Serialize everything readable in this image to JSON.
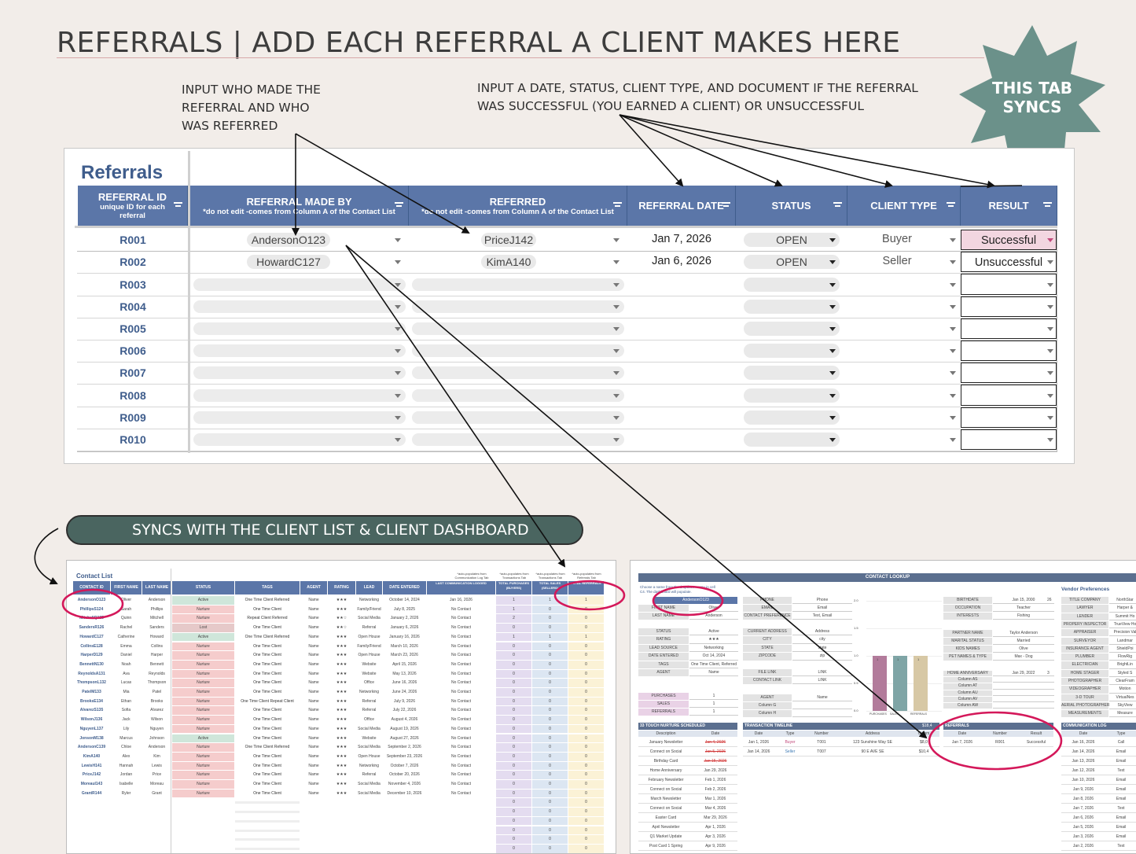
{
  "page": {
    "title": "REFERRALS | ADD EACH REFERRAL A CLIENT MAKES HERE",
    "note_left": [
      "INPUT WHO MADE THE",
      "REFERRAL AND WHO",
      "WAS REFERRED"
    ],
    "note_right": [
      "INPUT A DATE, STATUS, CLIENT TYPE, AND DOCUMENT IF THE REFERRAL",
      "WAS SUCCESSFUL (YOU EARNED A CLIENT) OR UNSUCCESSFUL"
    ],
    "badge": [
      "THIS TAB",
      "SYNCS"
    ],
    "banner": "SYNCS WITH THE CLIENT LIST & CLIENT DASHBOARD",
    "colors": {
      "header_blue": "#5b76a8",
      "badge_green": "#6b918a",
      "banner_green": "#4a6560",
      "circle_pink": "#d4185a"
    }
  },
  "sheet": {
    "title": "Referrals",
    "columns": [
      {
        "label": "REFERRAL ID",
        "sub": [
          "unique ID for each",
          "referral"
        ]
      },
      {
        "label": "REFERRAL MADE BY",
        "sub": [
          "*do not edit -comes from Column A of the Contact List"
        ]
      },
      {
        "label": "REFERRED",
        "sub": [
          "*do not edit -comes from Column A of the Contact List"
        ]
      },
      {
        "label": "REFERRAL DATE",
        "sub": []
      },
      {
        "label": "STATUS",
        "sub": []
      },
      {
        "label": "CLIENT TYPE",
        "sub": []
      },
      {
        "label": "RESULT",
        "sub": []
      }
    ],
    "rows": [
      {
        "id": "R001",
        "made_by": "AndersonO123",
        "referred": "PriceJ142",
        "date": "Jan 7, 2026",
        "status": "OPEN",
        "client_type": "Buyer",
        "result": "Successful"
      },
      {
        "id": "R002",
        "made_by": "HowardC127",
        "referred": "KimA140",
        "date": "Jan 6, 2026",
        "status": "OPEN",
        "client_type": "Seller",
        "result": "Unsuccessful"
      },
      {
        "id": "R003"
      },
      {
        "id": "R004"
      },
      {
        "id": "R005"
      },
      {
        "id": "R006"
      },
      {
        "id": "R007"
      },
      {
        "id": "R008"
      },
      {
        "id": "R009"
      },
      {
        "id": "R010"
      }
    ]
  },
  "contact_list": {
    "title": "Contact List",
    "notes": [
      "*auto-populates from Communication Log Tab",
      "*auto-populates from Transactions Tab",
      "*auto-populates from Transactions Tab",
      "*auto-populates from Referrals Tab"
    ],
    "headers": [
      "CONTACT ID",
      "FIRST NAME",
      "LAST NAME",
      "STATUS",
      "TAGS",
      "AGENT",
      "RATING",
      "LEAD SOURCE",
      "DATE ENTERED",
      "LAST COMMUNICATION LOGGED",
      "TOTAL PURCHASES (BUYERS)",
      "TOTAL SALES (SELLERS)",
      "TOTAL REFERRALS"
    ],
    "rows": [
      [
        "AndersonO123",
        "Oliver",
        "Anderson",
        "Active",
        "One Time Client  Referred",
        "Name",
        "★★★",
        "Networking",
        "October 14, 2024",
        "Jan 16, 2026",
        "1",
        "1",
        "1"
      ],
      [
        "PhillipsS124",
        "Sarah",
        "Phillips",
        "Nurture",
        "One Time Client",
        "Name",
        "★★★",
        "Family/Friend",
        "July 8, 2025",
        "No Contact",
        "1",
        "0",
        "0"
      ],
      [
        "MitchellQ125",
        "Quinn",
        "Mitchell",
        "Nurture",
        "Repeat Client  Referred",
        "Name",
        "★★☆",
        "Social Media",
        "January 2, 2026",
        "No Contact",
        "2",
        "0",
        "0"
      ],
      [
        "SandersR126",
        "Rachel",
        "Sanders",
        "Lost",
        "One Time Client",
        "Name",
        "★★☆",
        "Referral",
        "January 6, 2026",
        "No Contact",
        "0",
        "0",
        "0"
      ],
      [
        "HowardC127",
        "Catherine",
        "Howard",
        "Active",
        "One Time Client  Referred",
        "Name",
        "★★★",
        "Open House",
        "January 16, 2026",
        "No Contact",
        "1",
        "1",
        "1"
      ],
      [
        "CollinsE128",
        "Emma",
        "Collins",
        "Nurture",
        "One Time Client",
        "Name",
        "★★★",
        "Family/Friend",
        "March 10, 2026",
        "No Contact",
        "0",
        "0",
        "0"
      ],
      [
        "HarperD129",
        "Daniel",
        "Harper",
        "Nurture",
        "One Time Client",
        "Name",
        "★★★",
        "Open House",
        "March 23, 2026",
        "No Contact",
        "0",
        "0",
        "0"
      ],
      [
        "BennettN130",
        "Noah",
        "Bennett",
        "Nurture",
        "One Time Client",
        "Name",
        "★★★",
        "Website",
        "April 15, 2026",
        "No Contact",
        "0",
        "0",
        "0"
      ],
      [
        "ReynoldsA131",
        "Ava",
        "Reynolds",
        "Nurture",
        "One Time Client",
        "Name",
        "★★★",
        "Website",
        "May 13, 2026",
        "No Contact",
        "0",
        "0",
        "0"
      ],
      [
        "ThompsonL132",
        "Lucas",
        "Thompson",
        "Nurture",
        "One Time Client",
        "Name",
        "★★★",
        "Office",
        "June 16, 2026",
        "No Contact",
        "0",
        "0",
        "0"
      ],
      [
        "PatelM133",
        "Mia",
        "Patel",
        "Nurture",
        "One Time Client",
        "Name",
        "★★★",
        "Networking",
        "June 24, 2026",
        "No Contact",
        "0",
        "0",
        "0"
      ],
      [
        "BrooksE134",
        "Ethan",
        "Brooks",
        "Nurture",
        "One Time Client  Repeat Client",
        "Name",
        "★★★",
        "Referral",
        "July 9, 2026",
        "No Contact",
        "0",
        "0",
        "0"
      ],
      [
        "AlvarezS135",
        "Sofia",
        "Alvarez",
        "Nurture",
        "One Time Client",
        "Name",
        "★★★",
        "Referral",
        "July 22, 2026",
        "No Contact",
        "0",
        "0",
        "0"
      ],
      [
        "WilsonJ136",
        "Jack",
        "Wilson",
        "Nurture",
        "One Time Client",
        "Name",
        "★★★",
        "Office",
        "August 4, 2026",
        "No Contact",
        "0",
        "0",
        "0"
      ],
      [
        "NguyenL137",
        "Lily",
        "Nguyen",
        "Nurture",
        "One Time Client",
        "Name",
        "★★★",
        "Social Media",
        "August 19, 2026",
        "No Contact",
        "0",
        "0",
        "0"
      ],
      [
        "JonsonM138",
        "Marcus",
        "Johnson",
        "Active",
        "One Time Client",
        "Name",
        "★★★",
        "Website",
        "August 27, 2026",
        "No Contact",
        "0",
        "0",
        "0"
      ],
      [
        "AndersonC139",
        "Chloe",
        "Anderson",
        "Nurture",
        "One Time Client  Referred",
        "Name",
        "★★★",
        "Social Media",
        "September 2, 2026",
        "No Contact",
        "0",
        "0",
        "0"
      ],
      [
        "KimA140",
        "Alex",
        "Kim",
        "Nurture",
        "One Time Client",
        "Name",
        "★★★",
        "Open House",
        "September 23, 2026",
        "No Contact",
        "0",
        "0",
        "0"
      ],
      [
        "LewisH141",
        "Hannah",
        "Lewis",
        "Nurture",
        "One Time Client",
        "Name",
        "★★★",
        "Networking",
        "October 7, 2026",
        "No Contact",
        "0",
        "0",
        "0"
      ],
      [
        "PriceJ142",
        "Jordan",
        "Price",
        "Nurture",
        "One Time Client",
        "Name",
        "★★★",
        "Referral",
        "October 20, 2026",
        "No Contact",
        "0",
        "0",
        "0"
      ],
      [
        "MoreauI143",
        "Isabelle",
        "Moreau",
        "Nurture",
        "One Time Client",
        "Name",
        "★★★",
        "Social Media",
        "November 4, 2026",
        "No Contact",
        "0",
        "0",
        "0"
      ],
      [
        "GrantR144",
        "Ryler",
        "Grant",
        "Nurture",
        "One Time Client",
        "Name",
        "★★★",
        "Social Media",
        "December 10, 2026",
        "No Contact",
        "0",
        "0",
        "0"
      ]
    ]
  },
  "dashboard": {
    "title": "CONTACT LOOKUP",
    "instruction": [
      "Choose a name from the dropdown menu in cell",
      "C4. The dashboard will populate."
    ],
    "selected": "AndersonO123",
    "fields_a": [
      [
        "FIRST NAME",
        "Oliver"
      ],
      [
        "LAST NAME",
        "Anderson"
      ]
    ],
    "fields_b": [
      [
        "STATUS",
        "Active"
      ],
      [
        "RATING",
        "★★★"
      ],
      [
        "LEAD SOURCE",
        "Networking"
      ],
      [
        "DATE ENTERED",
        "Oct 14, 2024"
      ],
      [
        "TAGS",
        "One Time Client, Referred"
      ],
      [
        "AGENT",
        "Name"
      ]
    ],
    "fields_c": [
      [
        "PURCHASES",
        "1"
      ],
      [
        "SALES",
        "1"
      ],
      [
        "REFERRALS",
        "1"
      ]
    ],
    "contact": [
      [
        "PHONE",
        "Phone"
      ],
      [
        "EMAIL",
        "Email"
      ],
      [
        "CONTACT PREFERENCE",
        "Text, Email"
      ]
    ],
    "address": [
      [
        "CURRENT ADDRESS",
        "Address"
      ],
      [
        "CITY",
        "city"
      ],
      [
        "STATE",
        "state"
      ],
      [
        "ZIPCODE",
        "zip"
      ]
    ],
    "links": [
      [
        "FILE LINK",
        "LINK"
      ],
      [
        "CONTACT LINK",
        "LINK"
      ]
    ],
    "agent": [
      [
        "AGENT",
        "Name"
      ],
      [
        "Column G",
        ""
      ],
      [
        "Column H",
        ""
      ]
    ],
    "chart": {
      "type": "bar",
      "categories": [
        "PURCHASES",
        "SALES",
        "REFERRALS"
      ],
      "values": [
        1,
        1,
        1
      ],
      "ylim": [
        0,
        2
      ],
      "ticks": [
        "2.0",
        "1.5",
        "1.0",
        "0.5",
        "0.0"
      ]
    },
    "personal": [
      [
        "BIRTHDATE",
        "Jan 15, 2000",
        "26"
      ],
      [
        "OCCUPATION",
        "Teacher",
        ""
      ],
      [
        "INTERESTS",
        "Fishing",
        ""
      ]
    ],
    "family": [
      [
        "PARTNER NAME",
        "Taylor Anderson"
      ],
      [
        "MARITAL STATUS",
        "Married"
      ],
      [
        "KIDS NAMES",
        "Olive"
      ],
      [
        "PET NAMES & TYPE",
        "Max - Dog"
      ]
    ],
    "anniv": [
      [
        "HOME ANNIVERSARY",
        "Jan 29, 2022",
        "3"
      ],
      [
        "Column AS",
        "",
        ""
      ],
      [
        "Column AT",
        "",
        ""
      ],
      [
        "Column AU",
        "",
        ""
      ],
      [
        "Column AV",
        "",
        ""
      ],
      [
        "Column AW",
        "",
        ""
      ]
    ],
    "vendor_title": "Vendor Preferences",
    "vendors": [
      [
        "TITLE COMPANY",
        "NorthStar"
      ],
      [
        "LAWYER",
        "Harper &"
      ],
      [
        "LENDER",
        "Summit Ho"
      ],
      [
        "PROPERY INSPECTOR",
        "TrueView Ho"
      ],
      [
        "APPRAISER",
        "Precision Val"
      ],
      [
        "SURVEYOR",
        "Landmar"
      ],
      [
        "INSURANCE AGENT",
        "ShieldPoi"
      ],
      [
        "PLUMBER",
        "FlowRig"
      ],
      [
        "ELECTRICIAN",
        "BrightLin"
      ],
      [
        "HOME STAGER",
        "Styled S"
      ],
      [
        "PHOTOGRAPHER",
        "ClearFram"
      ],
      [
        "VIDEOGRAPHER",
        "Motion"
      ],
      [
        "3-D TOUR",
        "VirtualNes"
      ],
      [
        "AERIAL PHOTOGRAPHER",
        "SkyView"
      ],
      [
        "MEASUREMENTS",
        "Measure"
      ]
    ],
    "nurture_title": "33 TOUCH NURTURE SCHEDULED",
    "nurture_headers": [
      "Description",
      "Date"
    ],
    "nurture": [
      [
        "January Newsletter",
        "Jan 4, 2026"
      ],
      [
        "Connect on Social",
        "Jan 5, 2026"
      ],
      [
        "Birthday Card",
        "Jan 15, 2026"
      ],
      [
        "Home Anniversary",
        "Jan 29, 2026"
      ],
      [
        "February Newsletter",
        "Feb 1, 2026"
      ],
      [
        "Connect on Social",
        "Feb 2, 2026"
      ],
      [
        "March Newsletter",
        "Mar 1, 2026"
      ],
      [
        "Connect on Social",
        "Mar 4, 2026"
      ],
      [
        "Easter Card",
        "Mar 29, 2026"
      ],
      [
        "April Newsletter",
        "Apr 1, 2026"
      ],
      [
        "Q1 Market Update",
        "Apr 3, 2026"
      ],
      [
        "Post Card 1 Spring",
        "Apr 9, 2026"
      ],
      [
        "May Newsletter",
        "May 1, 2026"
      ]
    ],
    "trans_title": "TRANSACTION TIMELINE",
    "trans_amount": "$18,4",
    "trans_headers": [
      "Date",
      "Type",
      "Number",
      "Address",
      "Comm"
    ],
    "trans": [
      [
        "Jan 1, 2026",
        "Buyer",
        "T001",
        "123 Sunshine Way SE",
        "$8,0"
      ],
      [
        "Jan 14, 2026",
        "Seller",
        "T007",
        "90 E AVE SE",
        "$10,4"
      ]
    ],
    "ref_title": "REFERRALS",
    "ref_headers": [
      "Date",
      "Number",
      "Result"
    ],
    "ref": [
      [
        "Jan 7, 2026",
        "R001",
        "Successful"
      ]
    ],
    "comm_title": "COMMUNICATION LOG",
    "comm_headers": [
      "Date",
      "Type"
    ],
    "comm": [
      [
        "Jan 16, 2026",
        "Call"
      ],
      [
        "Jan 14, 2026",
        "Email"
      ],
      [
        "Jan 13, 2026",
        "Email"
      ],
      [
        "Jan 12, 2026",
        "Text"
      ],
      [
        "Jan 10, 2026",
        "Email"
      ],
      [
        "Jan 9, 2026",
        "Email"
      ],
      [
        "Jan 8, 2026",
        "Email"
      ],
      [
        "Jan 7, 2026",
        "Text"
      ],
      [
        "Jan 6, 2026",
        "Email"
      ],
      [
        "Jan 5, 2026",
        "Email"
      ],
      [
        "Jan 3, 2026",
        "Email"
      ],
      [
        "Jan 2, 2026",
        "Text"
      ]
    ]
  }
}
